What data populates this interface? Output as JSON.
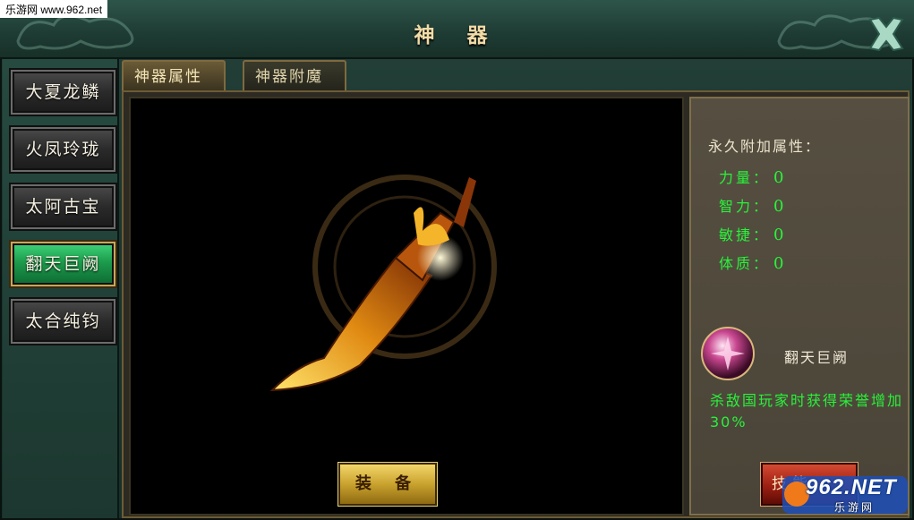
{
  "watermark": {
    "top_left": "乐游网 www.962.net",
    "badge_main": "962.NET",
    "badge_sub": "乐游网"
  },
  "window": {
    "title": "神 器"
  },
  "sidebar": {
    "items": [
      {
        "label": "大夏龙鳞",
        "active": false
      },
      {
        "label": "火凤玲珑",
        "active": false
      },
      {
        "label": "太阿古宝",
        "active": false
      },
      {
        "label": "翻天巨阙",
        "active": true
      },
      {
        "label": "太合纯钧",
        "active": false
      }
    ]
  },
  "tabs": [
    {
      "label": "神器属性",
      "active": true
    },
    {
      "label": "神器附魔",
      "active": false
    }
  ],
  "main": {
    "equip_label": "装 备"
  },
  "attributes": {
    "title": "永久附加属性：",
    "stats": [
      {
        "label": "力量：",
        "value": "0"
      },
      {
        "label": "智力：",
        "value": "0"
      },
      {
        "label": "敏捷：",
        "value": "0"
      },
      {
        "label": "体质：",
        "value": "0"
      }
    ]
  },
  "skill": {
    "name": "翻天巨阙",
    "description": "杀敌国玩家时获得荣誉增加30%",
    "button_label": "技能"
  },
  "colors": {
    "stat_green": "#29f23a",
    "active_green": "#1c9c4c",
    "gold": "#c9a22e"
  }
}
